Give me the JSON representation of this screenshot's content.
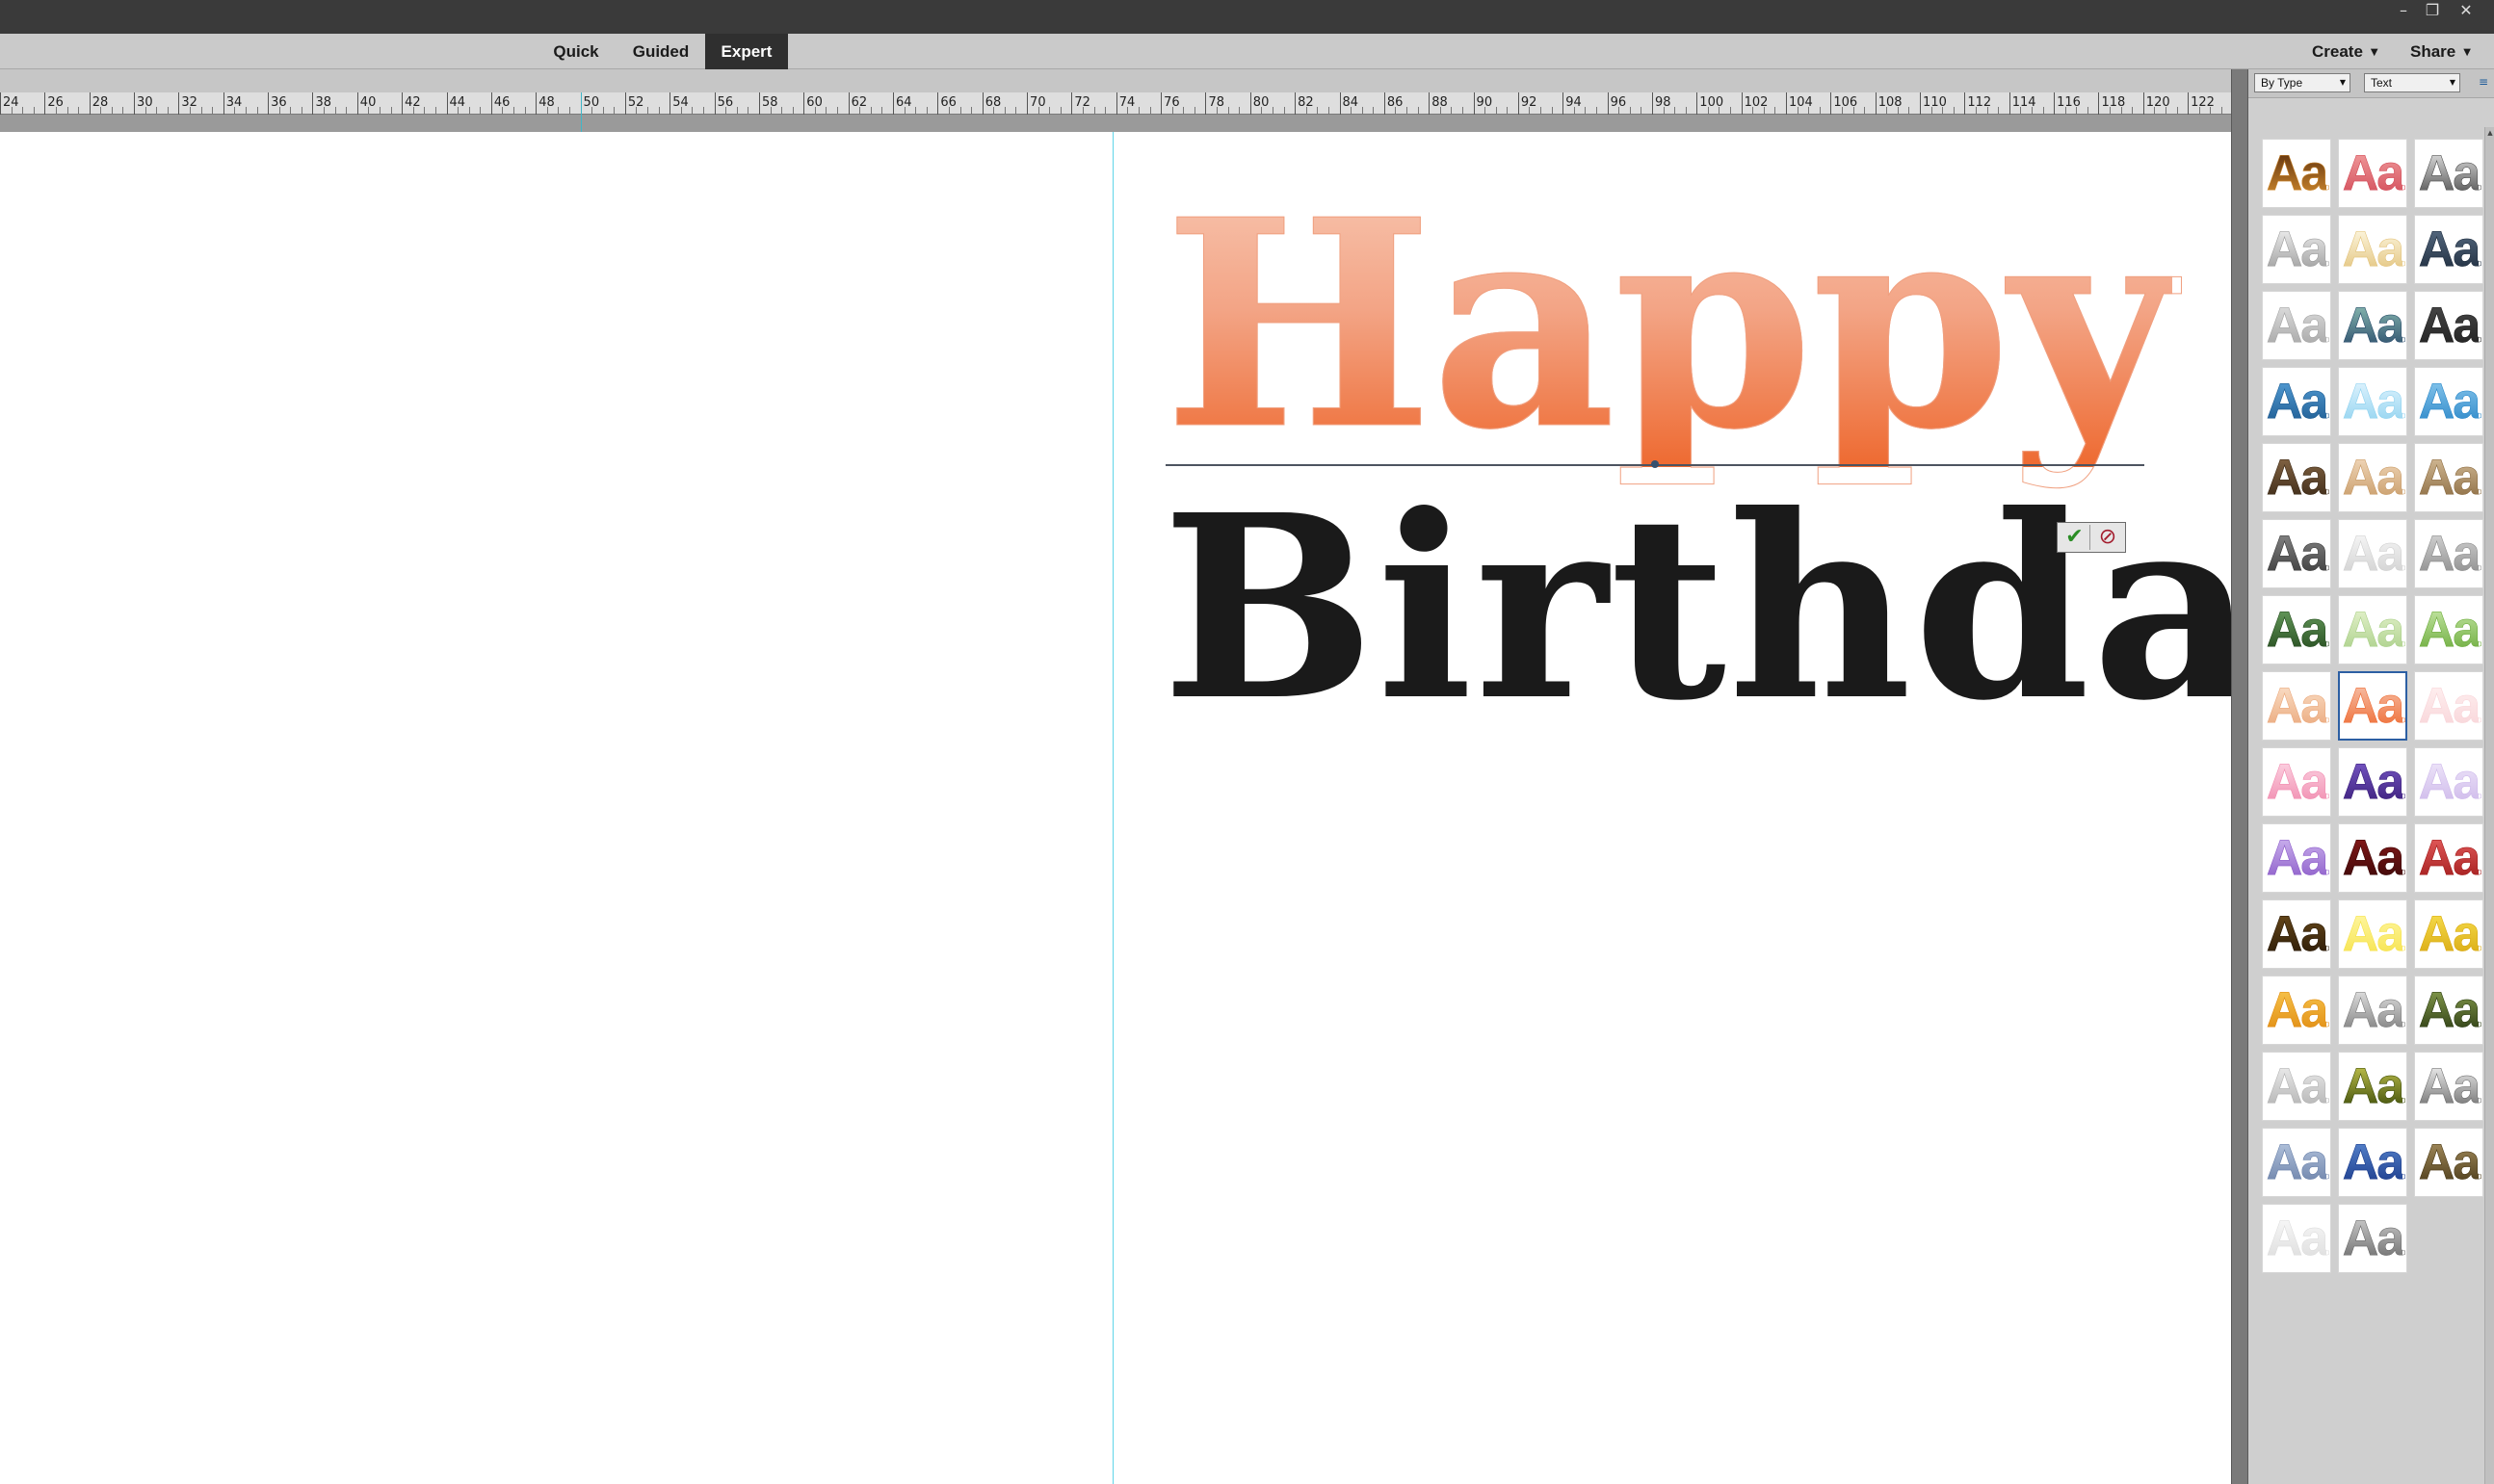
{
  "window": {
    "controls": [
      "minimize-icon",
      "restore-icon",
      "close-icon"
    ]
  },
  "modes": [
    {
      "label": "Quick",
      "active": false
    },
    {
      "label": "Guided",
      "active": false
    },
    {
      "label": "Expert",
      "active": true
    }
  ],
  "top_menu": {
    "create": "Create",
    "share": "Share"
  },
  "ruler": {
    "labels": [
      "24",
      "26",
      "28",
      "30",
      "32",
      "34",
      "36",
      "38",
      "40",
      "42",
      "44",
      "46",
      "48",
      "50",
      "52",
      "54",
      "56",
      "58",
      "60",
      "62",
      "64",
      "66",
      "68",
      "70",
      "72",
      "74",
      "76",
      "78",
      "80",
      "82",
      "84",
      "86",
      "88",
      "90",
      "92",
      "94",
      "96",
      "98",
      "100",
      "102",
      "104",
      "106",
      "108",
      "110",
      "112",
      "114",
      "116",
      "118",
      "120",
      "122"
    ]
  },
  "canvas": {
    "line1": "Happy",
    "line2": "Birthday",
    "line1_gradient": [
      "#f7c4ae",
      "#ee6a31"
    ],
    "line2_color": "#1a1a1a",
    "commit_icon": "checkmark-icon",
    "cancel_icon": "cancel-icon"
  },
  "panel": {
    "filter_type": "By Type",
    "filter_category": "Text",
    "menu_icon": "panel-menu-icon",
    "swatch_label": "Aa",
    "selected_index": 22,
    "swatches": [
      {
        "a": "#5a2e0d",
        "b": "#d08a2e"
      },
      {
        "a": "#f2a0a0",
        "b": "#d24b58"
      },
      {
        "a": "#e8e8e8",
        "b": "#4b4b4b"
      },
      {
        "a": "#f4f4f4",
        "b": "#9a9a9a"
      },
      {
        "a": "#fffbe8",
        "b": "#e2c27a"
      },
      {
        "a": "#5a6e85",
        "b": "#1e2c3d"
      },
      {
        "a": "#e2e2e2",
        "b": "#a3a3a3"
      },
      {
        "a": "#8ec0b5",
        "b": "#294a6a"
      },
      {
        "a": "#4a4a4a",
        "b": "#202020"
      },
      {
        "a": "#56a0d8",
        "b": "#1d5a90"
      },
      {
        "a": "#e6f6ff",
        "b": "#8fd2ef"
      },
      {
        "a": "#8cc9ee",
        "b": "#2b87c8"
      },
      {
        "a": "#8a6a48",
        "b": "#3a2816"
      },
      {
        "a": "#f4dcc0",
        "b": "#c79a66"
      },
      {
        "a": "#d8c09c",
        "b": "#8a6a40"
      },
      {
        "a": "#8a8a8a",
        "b": "#3a3a3a"
      },
      {
        "a": "#fafafa",
        "b": "#cfcfcf"
      },
      {
        "a": "#d8d8d8",
        "b": "#8a8a8a"
      },
      {
        "a": "#6aa060",
        "b": "#244a1e"
      },
      {
        "a": "#e8f4d0",
        "b": "#a9cf88"
      },
      {
        "a": "#c8e8a8",
        "b": "#6aaa3a"
      },
      {
        "a": "#fbe2cc",
        "b": "#eaa77a"
      },
      {
        "a": "#f7c4ae",
        "b": "#ee6a31"
      },
      {
        "a": "#fff2f2",
        "b": "#f8d4d8"
      },
      {
        "a": "#fdd8e6",
        "b": "#f08aae"
      },
      {
        "a": "#7a5ac8",
        "b": "#3a1e7a"
      },
      {
        "a": "#f0e8fa",
        "b": "#cdb8ea"
      },
      {
        "a": "#d0b8f0",
        "b": "#8a5ac8"
      },
      {
        "a": "#8a1a1a",
        "b": "#3a0808"
      },
      {
        "a": "#e86060",
        "b": "#a01a1a"
      },
      {
        "a": "#6a4a1a",
        "b": "#2a1a08"
      },
      {
        "a": "#fff8a8",
        "b": "#f6e24a"
      },
      {
        "a": "#f8e050",
        "b": "#d8a810"
      },
      {
        "a": "#f8c850",
        "b": "#e08a10"
      },
      {
        "a": "#eaeaea",
        "b": "#7a7a7a"
      },
      {
        "a": "#8aa050",
        "b": "#2a3a12"
      },
      {
        "a": "#f0f0f0",
        "b": "#b0b0b0"
      },
      {
        "a": "#c8c850",
        "b": "#3a4a08"
      },
      {
        "a": "#f8f8f8",
        "b": "#6a6a6a"
      },
      {
        "a": "#b8c8e0",
        "b": "#6a80a8"
      },
      {
        "a": "#5a88d0",
        "b": "#1a3a8a"
      },
      {
        "a": "#a89060",
        "b": "#4a3a18"
      },
      {
        "a": "#fafafa",
        "b": "#dcdcdc"
      },
      {
        "a": "#d0d0d0",
        "b": "#6a6a6a"
      }
    ]
  }
}
